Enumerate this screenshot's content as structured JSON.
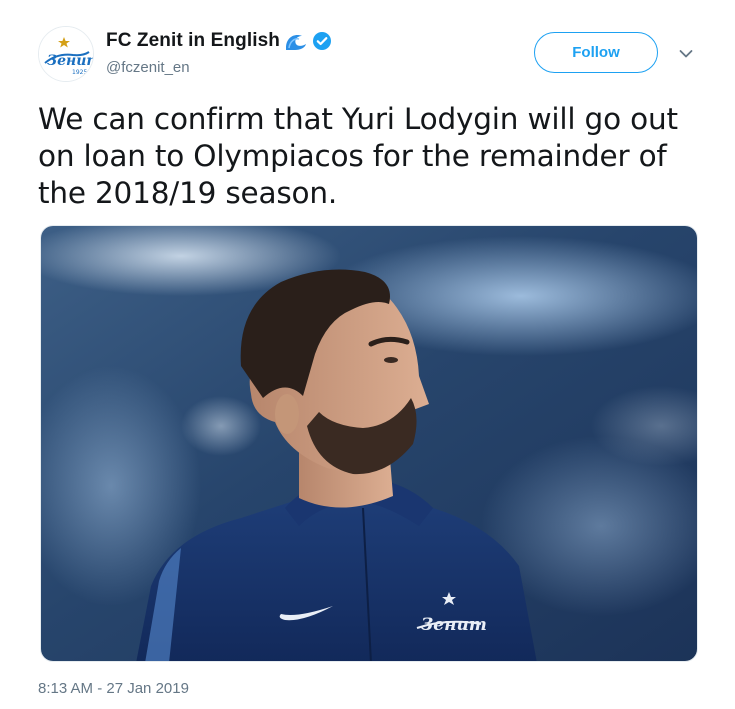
{
  "author": {
    "display_name": "FC Zenit in English",
    "handle": "@fczenit_en",
    "verified": true,
    "avatar_logo_text": "Зенит",
    "avatar_logo_year": "1925"
  },
  "actions": {
    "follow_label": "Follow"
  },
  "tweet": {
    "text": "We can confirm that Yuri Lodygin will go out on loan to Olympiacos for the remainder of the 2018/19 season.",
    "timestamp": "8:13 AM - 27 Jan 2019"
  },
  "media": {
    "description_icon": "photo",
    "jersey_logo_text": "Зенит"
  },
  "colors": {
    "accent": "#1da1f2",
    "text_primary": "#14171a",
    "text_secondary": "#657786",
    "zenit_blue": "#1a6fc0"
  },
  "icons": {
    "wave": "wave-icon",
    "verified": "verified-badge-icon",
    "chevron": "chevron-down-icon"
  }
}
